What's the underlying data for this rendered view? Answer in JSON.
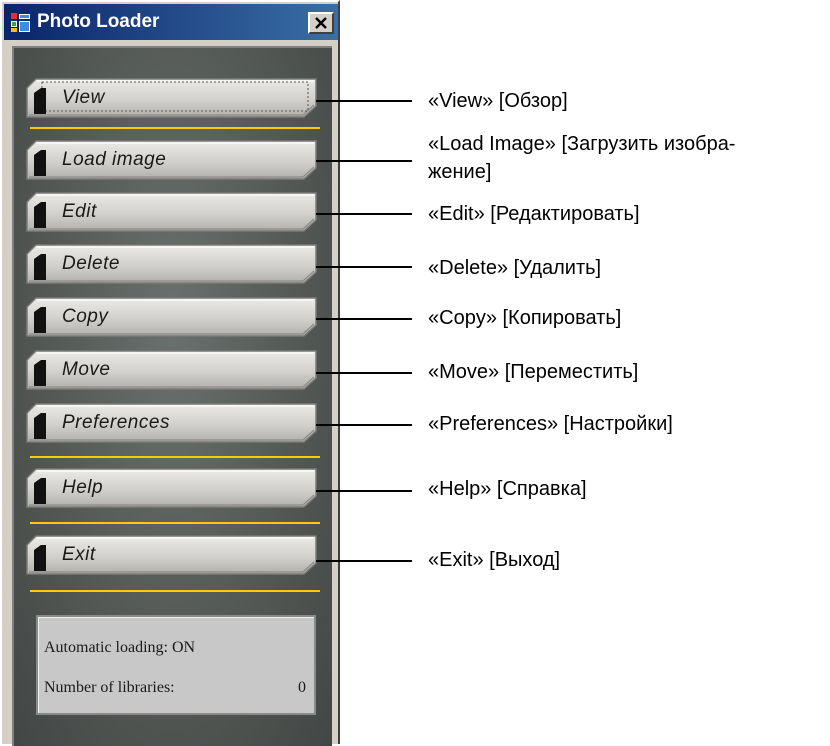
{
  "window": {
    "title": "Photo Loader",
    "close_label": "×",
    "icon": "photo-loader-app-icon"
  },
  "menu": {
    "items": [
      {
        "label": "View",
        "annotation": "«View» [Обзор]"
      },
      {
        "label": "Load image",
        "annotation_line1": "«Load Image» [Загрузить изобра-",
        "annotation_line2": "жение]"
      },
      {
        "label": "Edit",
        "annotation": "«Edit» [Редактировать]"
      },
      {
        "label": "Delete",
        "annotation": "«Delete» [Удалить]"
      },
      {
        "label": "Copy",
        "annotation": "«Copy» [Копировать]"
      },
      {
        "label": "Move",
        "annotation": "«Move» [Переместить]"
      },
      {
        "label": "Preferences",
        "annotation": "«Preferences» [Настройки]"
      },
      {
        "label": "Help",
        "annotation": "«Help» [Справка]"
      },
      {
        "label": "Exit",
        "annotation": "«Exit» [Выход]"
      }
    ]
  },
  "status": {
    "auto_loading_label": "Automatic loading: ON",
    "libraries_label": "Number of libraries:",
    "libraries_count": "0"
  },
  "colors": {
    "separator": "#ffcc00",
    "panel_bg": "#545956",
    "titlebar": "#0a246a"
  }
}
